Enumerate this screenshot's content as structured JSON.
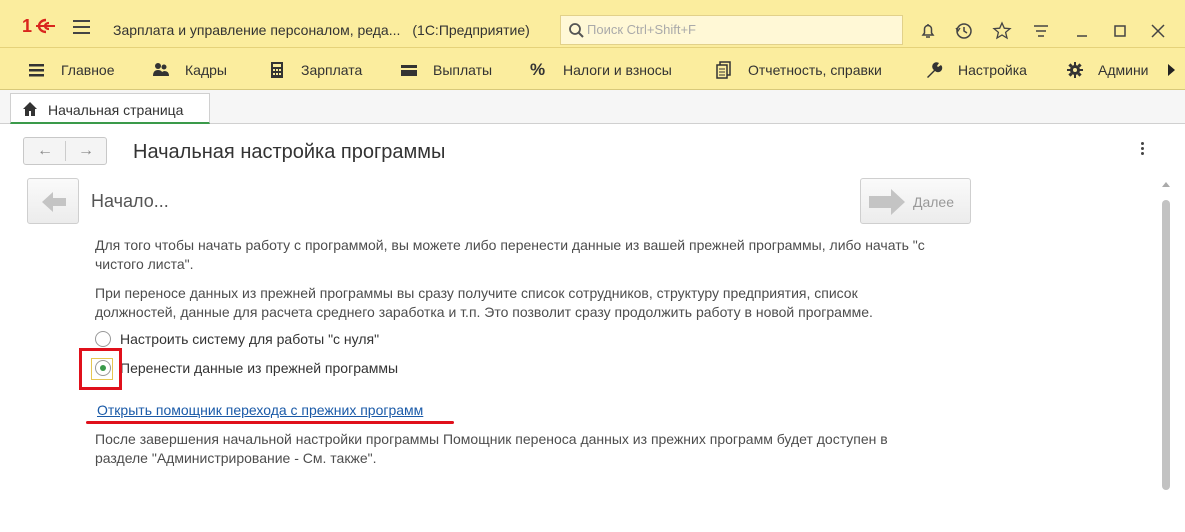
{
  "titlebar": {
    "logo": "1С",
    "app_title": "Зарплата и управление персоналом, реда...",
    "platform": "(1С:Предприятие)",
    "search_placeholder": "Поиск Ctrl+Shift+F",
    "icons": [
      "bell-icon",
      "history-icon",
      "star-icon",
      "settings-list-icon",
      "minimize-icon",
      "maximize-icon",
      "close-icon"
    ]
  },
  "menu": {
    "items": [
      {
        "label": "Главное",
        "icon": "hamburger-icon"
      },
      {
        "label": "Кадры",
        "icon": "people-icon"
      },
      {
        "label": "Зарплата",
        "icon": "calculator-icon"
      },
      {
        "label": "Выплаты",
        "icon": "wallet-icon"
      },
      {
        "label": "Налоги и взносы",
        "icon": "percent-icon"
      },
      {
        "label": "Отчетность, справки",
        "icon": "documents-icon"
      },
      {
        "label": "Настройка",
        "icon": "wrench-icon"
      },
      {
        "label": "Админи",
        "icon": "gear-icon"
      }
    ]
  },
  "tabs": [
    {
      "label": "Начальная страница",
      "icon": "home-icon",
      "active": true
    }
  ],
  "form": {
    "title": "Начальная настройка программы",
    "step_title": "Начало...",
    "next_label": "Далее",
    "paragraph1": "Для того чтобы начать работу с программой, вы можете либо перенести данные из вашей прежней программы, либо начать \"с чистого листа\".",
    "paragraph2": "При переносе данных из прежней программы вы сразу получите список сотрудников, структуру предприятия, список должностей, данные для расчета среднего заработка и т.п. Это позволит сразу продолжить работу в новой программе.",
    "options": [
      {
        "label": "Настроить систему для работы \"с нуля\"",
        "checked": false
      },
      {
        "label": "Перенести данные из прежней программы",
        "checked": true
      }
    ],
    "link": "Открыть помощник перехода с прежних программ",
    "paragraph3": "После завершения начальной настройки программы Помощник переноса данных из прежних программ будет доступен в разделе \"Администрирование - См. также\"."
  },
  "colors": {
    "header_bg": "#fbed9e",
    "accent_green": "#3a9a4a",
    "link": "#1a5aa8",
    "highlight_red": "#e0101b"
  }
}
